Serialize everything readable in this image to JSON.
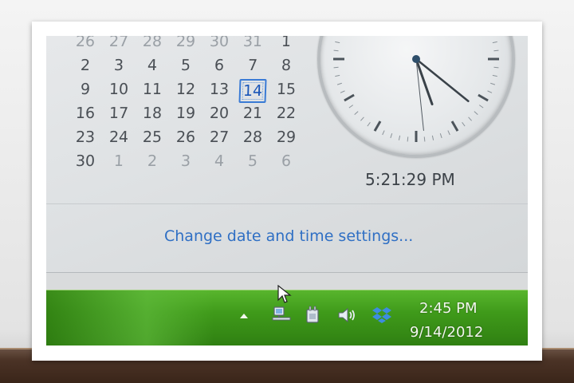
{
  "calendar": {
    "rows": [
      [
        "26",
        "27",
        "28",
        "29",
        "30",
        "31",
        "1"
      ],
      [
        "2",
        "3",
        "4",
        "5",
        "6",
        "7",
        "8"
      ],
      [
        "9",
        "10",
        "11",
        "12",
        "13",
        "14",
        "15"
      ],
      [
        "16",
        "17",
        "18",
        "19",
        "20",
        "21",
        "22"
      ],
      [
        "23",
        "24",
        "25",
        "26",
        "27",
        "28",
        "29"
      ],
      [
        "30",
        "1",
        "2",
        "3",
        "4",
        "5",
        "6"
      ]
    ],
    "today": "14"
  },
  "clock": {
    "time_text": "5:21:29 PM",
    "hours": 5,
    "minutes": 21,
    "seconds": 29
  },
  "flyout": {
    "link_text": "Change date and time settings..."
  },
  "taskbar": {
    "time": "2:45 PM",
    "date": "9/14/2012",
    "icons": [
      "show-hidden-icons-arrow-icon",
      "network-icon",
      "power-icon",
      "volume-icon",
      "dropbox-icon"
    ]
  },
  "colors": {
    "taskbar_green": "#3f9a1a",
    "link_blue": "#2f6fc4",
    "today_highlight": "#3a7bd5"
  }
}
